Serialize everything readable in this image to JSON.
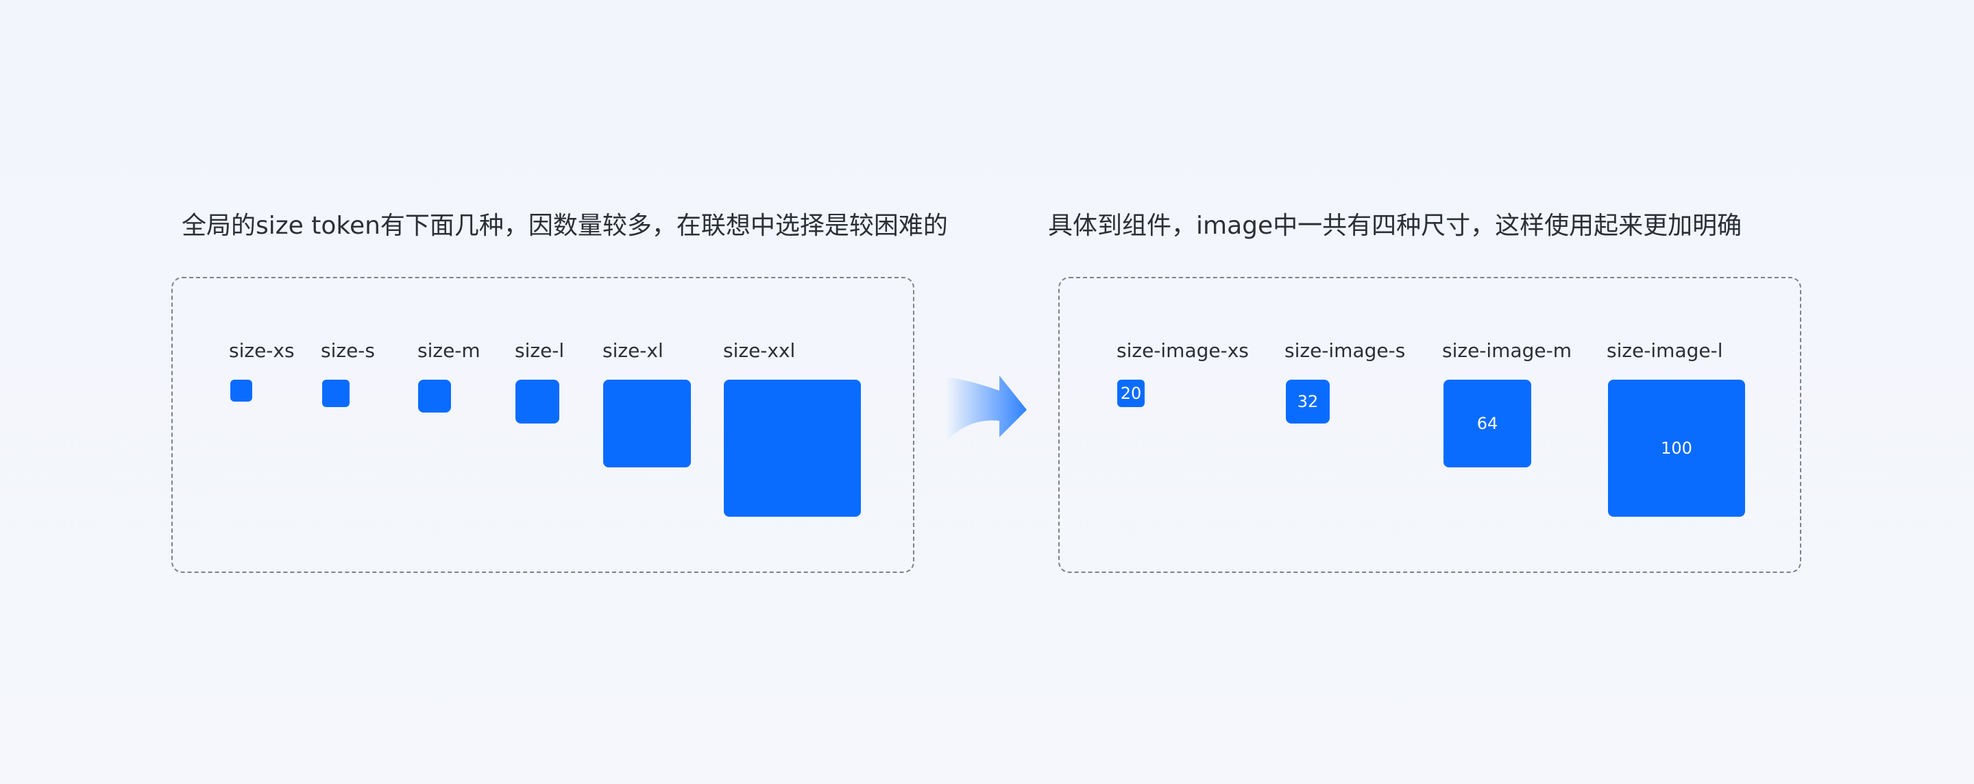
{
  "left_panel": {
    "heading": "全局的size token有下面几种，因数量较多，在联想中选择是较困难的",
    "tokens": [
      {
        "label": "size-xs"
      },
      {
        "label": "size-s"
      },
      {
        "label": "size-m"
      },
      {
        "label": "size-l"
      },
      {
        "label": "size-xl"
      },
      {
        "label": "size-xxl"
      }
    ]
  },
  "right_panel": {
    "heading": "具体到组件，image中一共有四种尺寸，这样使用起来更加明确",
    "tokens": [
      {
        "label": "size-image-xs",
        "value": "20"
      },
      {
        "label": "size-image-s",
        "value": "32"
      },
      {
        "label": "size-image-m",
        "value": "64"
      },
      {
        "label": "size-image-l",
        "value": "100"
      }
    ]
  },
  "colors": {
    "swatch": "#0a6cff",
    "background": "#f3f6fc",
    "text": "#2b2f36",
    "dashed_border": "#7d8189"
  },
  "icons": {
    "transition_arrow": "arrow-right-icon"
  }
}
